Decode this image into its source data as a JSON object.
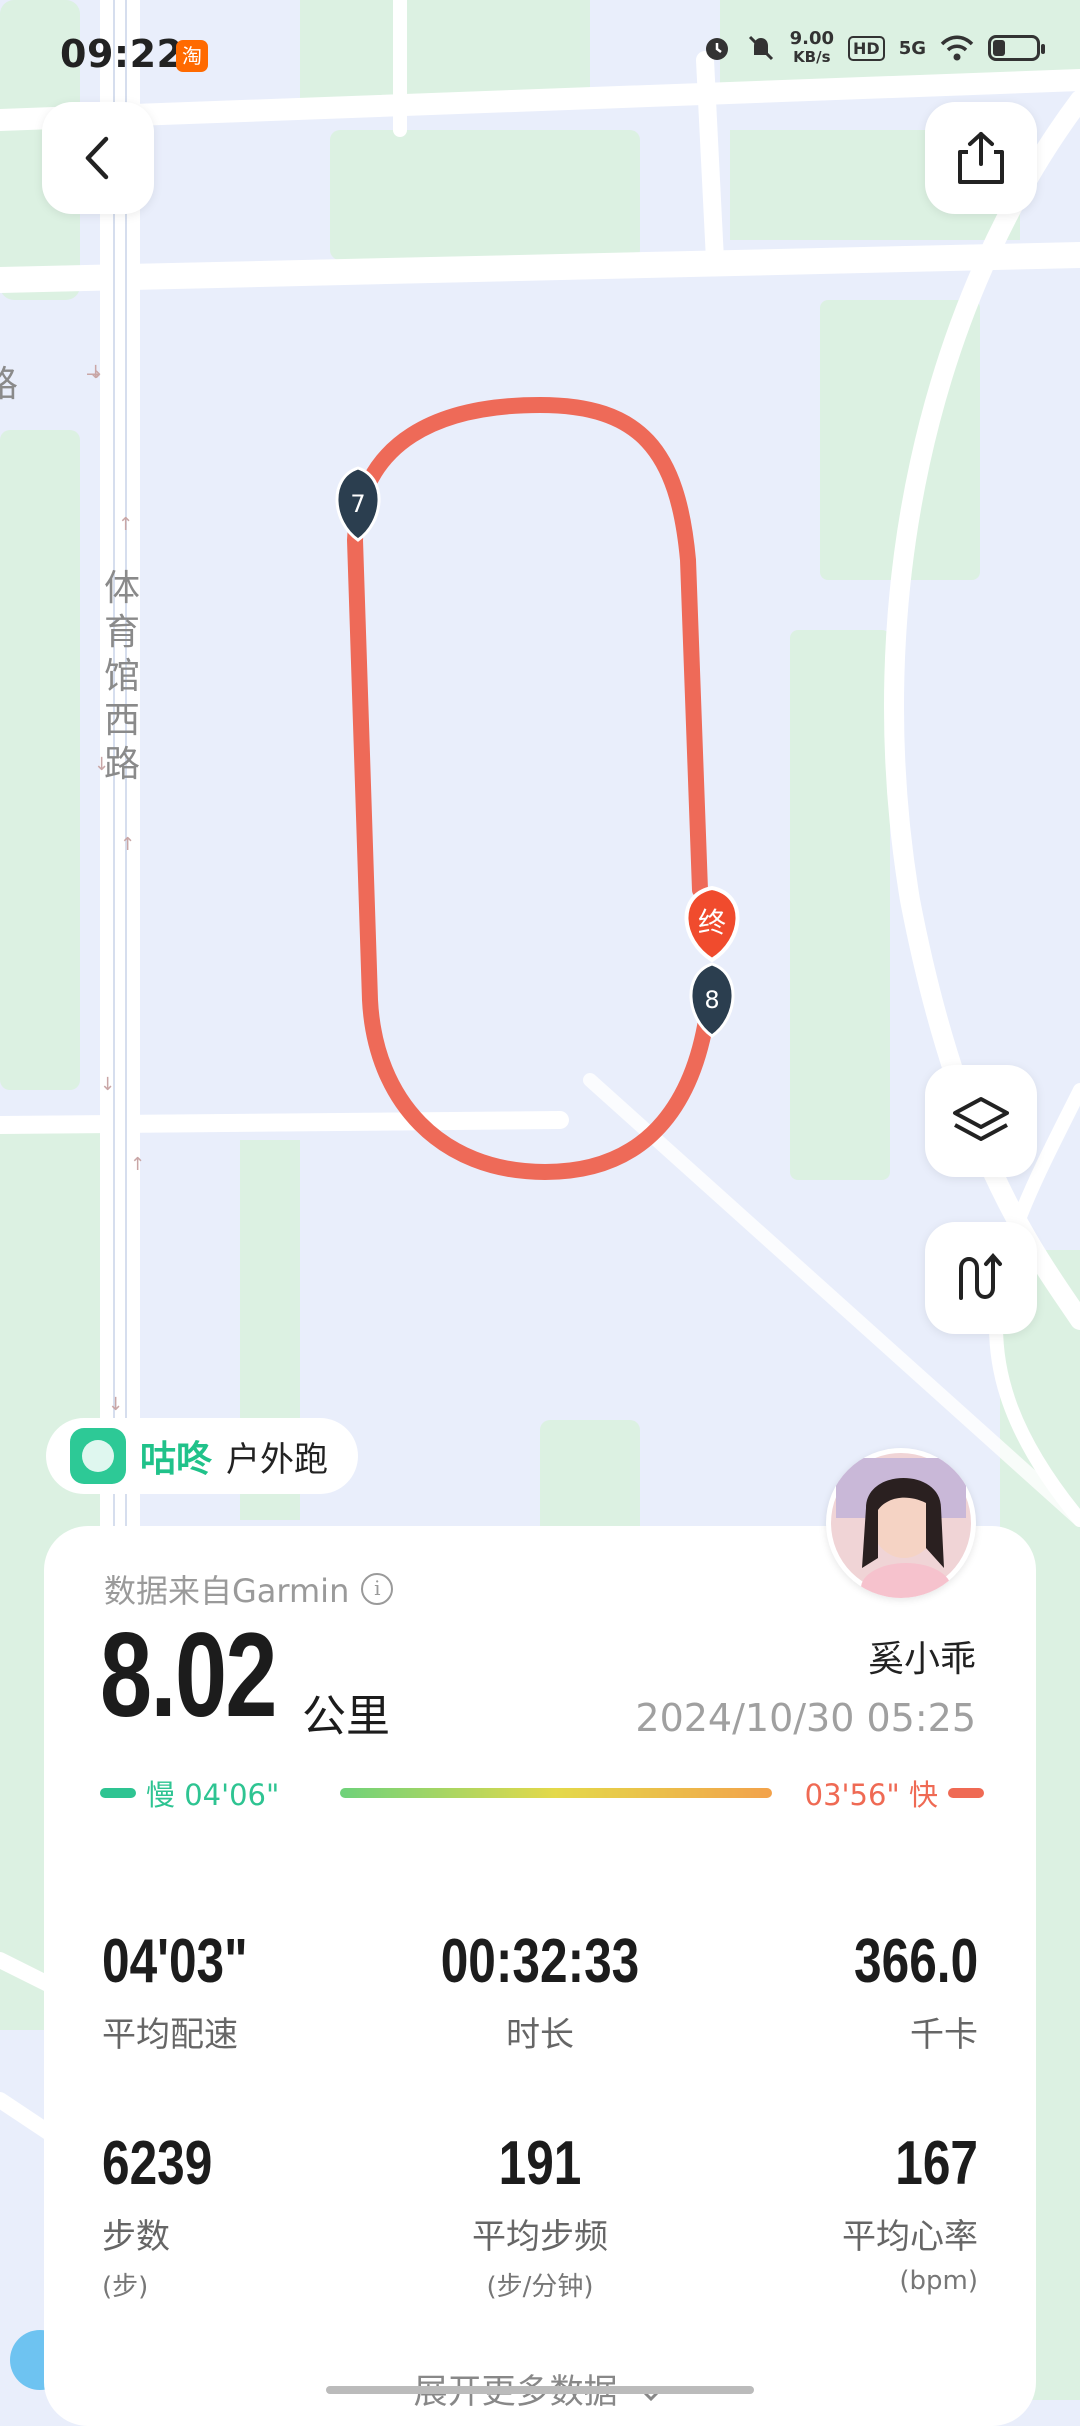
{
  "status_bar": {
    "time": "09:22",
    "taobao_badge": "淘",
    "net_speed_value": "9.00",
    "net_speed_unit": "KB/s",
    "hd_label": "HD",
    "network_label": "5G"
  },
  "map": {
    "road_label_chars": [
      "体",
      "育",
      "馆",
      "西",
      "路"
    ],
    "edge_road_label": "路",
    "markers": [
      "7",
      "8"
    ],
    "end_marker": "终",
    "route_color": "#ee6a58"
  },
  "brand": {
    "name": "咕咚",
    "activity": "户外跑",
    "color": "#20c28a"
  },
  "summary": {
    "source": "数据来自Garmin",
    "info_glyph": "i",
    "distance": "8.02",
    "distance_unit": "公里",
    "user_name": "奚小乖",
    "datetime": "2024/10/30 05:25"
  },
  "pace_bar": {
    "slow_label": "慢 04'06\"",
    "fast_label": "03'56\" 快",
    "slow_color": "#2ec492",
    "fast_color": "#ef6a54"
  },
  "stats": {
    "avg_pace": {
      "value": "04'03\"",
      "label": "平均配速"
    },
    "duration": {
      "value": "00:32:33",
      "label": "时长"
    },
    "calories": {
      "value": "366.0",
      "label": "千卡"
    },
    "steps": {
      "value": "6239",
      "label": "步数",
      "unit": "(步)"
    },
    "cadence": {
      "value": "191",
      "label": "平均步频",
      "unit": "(步/分钟)"
    },
    "heart_rate": {
      "value": "167",
      "label": "平均心率",
      "unit": "(bpm)"
    }
  },
  "expand_label": "展开更多数据",
  "icons": [
    "back-arrow-icon",
    "share-icon",
    "layers-icon",
    "route-toggle-icon",
    "info-icon",
    "chevron-down-icon",
    "alarm-icon",
    "mute-icon",
    "wifi-icon",
    "battery-icon"
  ]
}
